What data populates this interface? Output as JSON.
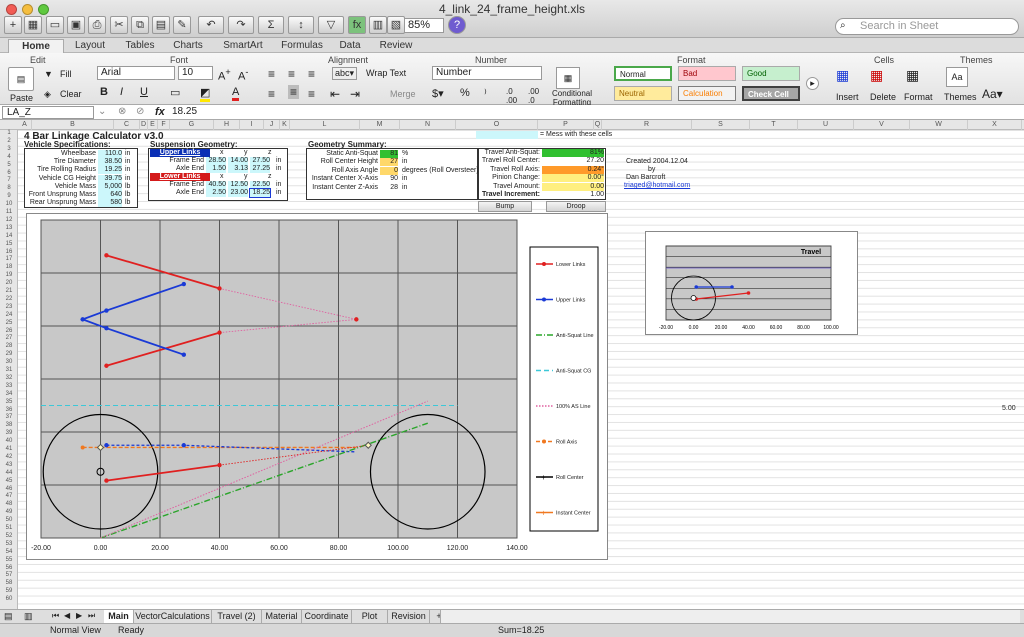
{
  "window": {
    "title": "4_link_24_frame_height.xls",
    "zoom": "85%",
    "search_placeholder": "Search in Sheet"
  },
  "ribbon_tabs": [
    "Home",
    "Layout",
    "Tables",
    "Charts",
    "SmartArt",
    "Formulas",
    "Data",
    "Review"
  ],
  "ribbon": {
    "groups": {
      "edit": "Edit",
      "font": "Font",
      "alignment": "Alignment",
      "number": "Number",
      "format": "Format",
      "cells": "Cells",
      "themes": "Themes"
    },
    "paste": "Paste",
    "fill": "Fill",
    "clear": "Clear",
    "font_name": "Arial",
    "font_size": "10",
    "wrap_text": "Wrap Text",
    "merge": "Merge",
    "number_format": "Number",
    "conditional_formatting": "Conditional Formatting",
    "styles": {
      "normal": "Normal",
      "bad": "Bad",
      "good": "Good",
      "neutral": "Neutral",
      "calculation": "Calculation",
      "check_cell": "Check Cell"
    },
    "insert": "Insert",
    "delete": "Delete",
    "format": "Format",
    "themes": "Themes"
  },
  "formula_bar": {
    "name_box": "LA_Z",
    "fx": "fx",
    "value": "18.25"
  },
  "columns": [
    "A",
    "B",
    "C",
    "D",
    "E",
    "F",
    "G",
    "H",
    "I",
    "J",
    "K",
    "L",
    "M",
    "N",
    "O",
    "P",
    "Q",
    "R",
    "S",
    "T",
    "U",
    "V",
    "W",
    "X"
  ],
  "sheet": {
    "title": "4 Bar Linkage Calculator v3.0",
    "vehicle": {
      "header": "Vehicle Specifications:",
      "rows": [
        [
          "Wheelbase",
          "110.0",
          "in"
        ],
        [
          "Tire Diameter",
          "38.50",
          "in"
        ],
        [
          "Tire Rolling Radius",
          "19.25",
          "in"
        ],
        [
          "Vehicle CG Height",
          "39.75",
          "in"
        ],
        [
          "Vehicle Mass",
          "5,000",
          "lb"
        ],
        [
          "Front Unsprung Mass",
          "640",
          "lb"
        ],
        [
          "Rear Unsprung Mass",
          "580",
          "lb"
        ]
      ]
    },
    "suspension": {
      "header": "Suspension Geometry:",
      "upper": "Upper Links",
      "lower": "Lower Links",
      "cols": [
        "x",
        "y",
        "z"
      ],
      "rows": [
        [
          "Frame End",
          "28.50",
          "14.00",
          "27.50",
          "in"
        ],
        [
          "Axle End",
          "1.50",
          "3.13",
          "27.25",
          "in"
        ],
        [
          "Frame End",
          "40.50",
          "12.50",
          "22.50",
          "in"
        ],
        [
          "Axle End",
          "2.50",
          "23.00",
          "18.25",
          "in"
        ]
      ]
    },
    "geometry": {
      "header": "Geometry Summary:",
      "rows": [
        [
          "Static Anti-Squat",
          "81",
          "%"
        ],
        [
          "Roll Center Height",
          "27",
          "in"
        ],
        [
          "Roll Axis Angle",
          "0",
          "degrees (Roll Oversteer)"
        ],
        [
          "Instant Center X-Axis",
          "90",
          "in"
        ],
        [
          "Instant Center Z-Axis",
          "28",
          "in"
        ]
      ]
    },
    "travel": {
      "rows": [
        [
          "Travel Anti-Squat:",
          "81%"
        ],
        [
          "Travel Roll Center:",
          "27.20"
        ],
        [
          "Travel Roll Axis:",
          "0.24°"
        ],
        [
          "Pinion Change:",
          "0.00°"
        ],
        [
          "Travel Amount:",
          "0.00"
        ],
        [
          "Travel Increment:",
          "1.00"
        ]
      ],
      "bump": "Bump",
      "droop": "Droop"
    },
    "legend_note": "= Mess with these cells",
    "credits": [
      "Created 2004.12.04",
      "by",
      "Dan Barcroft",
      "triaged@hotmail.com"
    ],
    "stray": "5.00"
  },
  "main_chart": {
    "x_ticks": [
      "-20.00",
      "0.00",
      "20.00",
      "40.00",
      "60.00",
      "80.00",
      "100.00",
      "120.00",
      "140.00"
    ],
    "legend": [
      "Lower Links",
      "Upper Links",
      "Anti-Squat Line",
      "Anti-Squat CG",
      "100% AS Line",
      "Roll Axis",
      "Roll Center",
      "Instant Center"
    ],
    "colors": {
      "lower": "#e02020",
      "upper": "#1a3ad6",
      "antisquat": "#2aa52a",
      "cg": "#3cc8d8",
      "as100": "#e060a0",
      "roll": "#f07820"
    }
  },
  "travel_chart": {
    "title": "Travel",
    "x_ticks": [
      "-20.00",
      "0.00",
      "20.00",
      "40.00",
      "60.00",
      "80.00",
      "100.00"
    ]
  },
  "sheet_tabs": [
    "Main",
    "VectorCalculations",
    "Travel (2)",
    "Material",
    "Coordinate",
    "Plot",
    "Revision"
  ],
  "status": {
    "view": "Normal View",
    "ready": "Ready",
    "sum": "Sum=18.25"
  }
}
